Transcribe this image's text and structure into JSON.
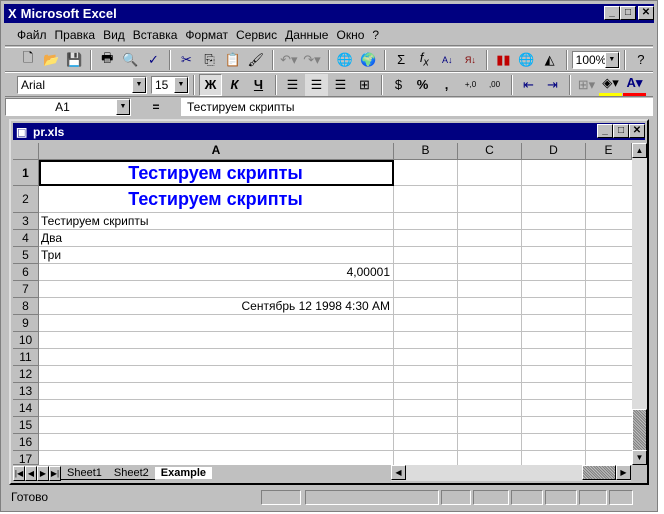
{
  "app": {
    "title": "Microsoft Excel"
  },
  "menu": [
    "Файл",
    "Правка",
    "Вид",
    "Вставка",
    "Формат",
    "Сервис",
    "Данные",
    "Окно",
    "?"
  ],
  "toolbar": {
    "zoom": "100%",
    "font": "Arial",
    "size": "15",
    "bold": "Ж",
    "italic": "К",
    "underline": "Ч"
  },
  "formula_bar": {
    "name_box": "A1",
    "equals": "=",
    "value": "Тестируем скрипты"
  },
  "workbook": {
    "title": "pr.xls",
    "columns": [
      "A",
      "B",
      "C",
      "D",
      "E"
    ],
    "rows": [
      "1",
      "2",
      "3",
      "4",
      "5",
      "6",
      "7",
      "8",
      "9",
      "10",
      "11",
      "12",
      "13",
      "14",
      "15",
      "16",
      "17"
    ],
    "cells": {
      "A1": "Тестируем скрипты",
      "A2": "Тестируем скрипты",
      "A3": "Тестируем скрипты",
      "A4": "Два",
      "A5": "Три",
      "A6": "4,00001",
      "A8": "Сентябрь 12 1998 4:30 AM"
    },
    "sheets": [
      "Sheet1",
      "Sheet2",
      "Example"
    ],
    "active_sheet": "Example"
  },
  "status": {
    "text": "Готово"
  },
  "colors": {
    "titlebar": "#000080",
    "heading_text": "#0000ff",
    "chrome": "#c0c0c0"
  }
}
